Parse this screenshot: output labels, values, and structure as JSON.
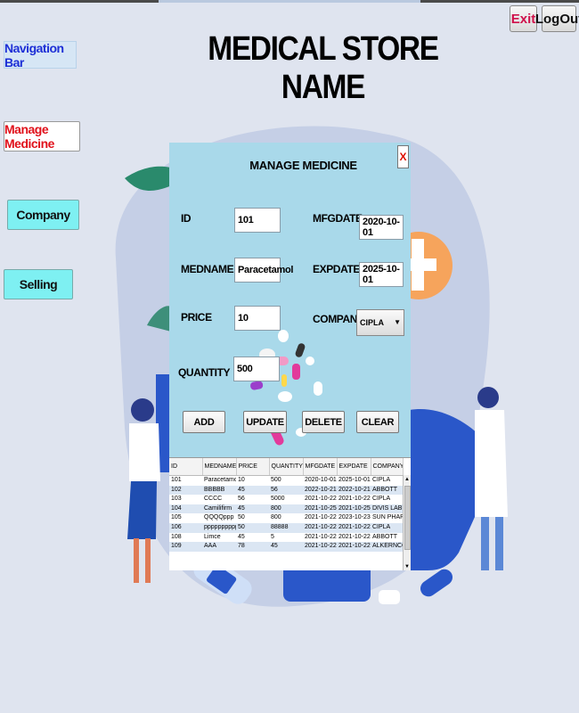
{
  "app": {
    "title": "MEDICAL STORE NAME",
    "exit_label": "Exit",
    "logout_label": "LogOut"
  },
  "sidebar": {
    "nav_label": "Navigation Bar",
    "items": [
      {
        "label": "Manage Medicine"
      },
      {
        "label": "Company"
      },
      {
        "label": "Selling"
      }
    ]
  },
  "dialog": {
    "title": "MANAGE MEDICINE",
    "close_label": "X",
    "fields": {
      "id": {
        "label": "ID",
        "value": "101"
      },
      "medname": {
        "label": "MEDNAME",
        "value": "Paracetamol"
      },
      "price": {
        "label": "PRICE",
        "value": "10"
      },
      "quantity": {
        "label": "QUANTITY",
        "value": "500"
      },
      "mfgdate": {
        "label": "MFGDATE",
        "value": "2020-10-01"
      },
      "expdate": {
        "label": "EXPDATE",
        "value": "2025-10-01"
      },
      "company": {
        "label": "COMPANY",
        "value": "CIPLA"
      }
    },
    "buttons": {
      "add": "ADD",
      "update": "UPDATE",
      "delete": "DELETE",
      "clear": "CLEAR"
    },
    "table": {
      "headers": [
        "ID",
        "MEDNAME",
        "PRICE",
        "QUANTITY",
        "MFGDATE",
        "EXPDATE",
        "COMPANY"
      ],
      "rows": [
        [
          "101",
          "Paracetamol",
          "10",
          "500",
          "2020-10-01",
          "2025-10-01",
          "CIPLA"
        ],
        [
          "102",
          "BBBBB",
          "45",
          "56",
          "2022-10-21",
          "2022-10-21",
          "ABBOTT"
        ],
        [
          "103",
          "CCCC",
          "56",
          "5000",
          "2021-10-22",
          "2021-10-22",
          "CIPLA"
        ],
        [
          "104",
          "Camilifirm",
          "45",
          "800",
          "2021-10-25",
          "2021-10-25",
          "DIVIS LAB"
        ],
        [
          "105",
          "QQQQppp",
          "50",
          "800",
          "2021-10-22",
          "2023-10-23",
          "SUN PHARM"
        ],
        [
          "106",
          "pppppppppp",
          "50",
          "88888",
          "2021-10-22",
          "2021-10-22",
          "CIPLA"
        ],
        [
          "108",
          "Limce",
          "45",
          "5",
          "2021-10-22",
          "2021-10-22",
          "ABBOTT"
        ],
        [
          "109",
          "AAA",
          "78",
          "45",
          "2021-10-22",
          "2021-10-22",
          "ALKERNCO"
        ]
      ]
    }
  },
  "colors": {
    "background": "#dfe4ef",
    "dialog_bg": "#a9d9ea",
    "accent_cyan": "#7ef0f2",
    "exit_red": "#d0104a"
  }
}
